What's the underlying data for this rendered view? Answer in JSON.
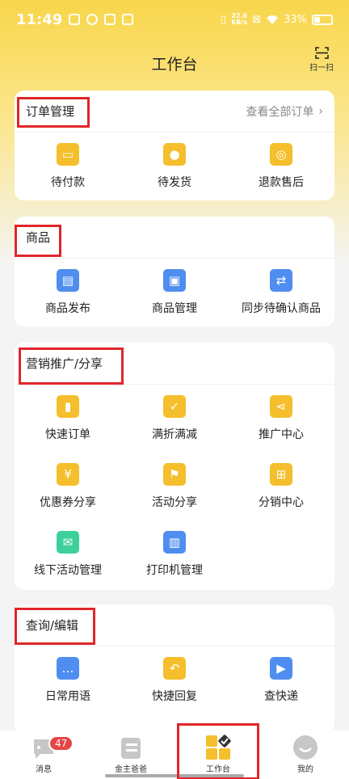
{
  "status_bar": {
    "time": "11:49",
    "net_speed_value": "22.6",
    "net_speed_unit": "KB/s",
    "battery": "33%"
  },
  "header": {
    "title": "工作台",
    "scan_label": "扫一扫"
  },
  "order_card": {
    "title": "订单管理",
    "more_link": "查看全部订单",
    "items": [
      {
        "label": "待付款",
        "icon": "ticket-icon",
        "color": "#f5be2c"
      },
      {
        "label": "待发货",
        "icon": "location-pin-icon",
        "color": "#f5be2c"
      },
      {
        "label": "退款售后",
        "icon": "refund-coin-icon",
        "color": "#f5be2c"
      }
    ]
  },
  "goods_card": {
    "title": "商品",
    "items": [
      {
        "label": "商品发布",
        "icon": "clipboard-icon",
        "color": "#4f8ef0"
      },
      {
        "label": "商品管理",
        "icon": "document-clock-icon",
        "color": "#4f8ef0"
      },
      {
        "label": "同步待确认商品",
        "icon": "sync-arrows-icon",
        "color": "#4f8ef0"
      }
    ]
  },
  "marketing_card": {
    "title": "营销推广/分享",
    "items": [
      {
        "label": "快速订单",
        "icon": "quick-order-icon",
        "color": "#f5be2c"
      },
      {
        "label": "满折满减",
        "icon": "discount-check-icon",
        "color": "#f5be2c"
      },
      {
        "label": "推广中心",
        "icon": "share-icon",
        "color": "#f5be2c"
      },
      {
        "label": "优惠券分享",
        "icon": "coupon-yen-icon",
        "color": "#f5be2c"
      },
      {
        "label": "活动分享",
        "icon": "flag-icon",
        "color": "#f5be2c"
      },
      {
        "label": "分销中心",
        "icon": "distribution-tree-icon",
        "color": "#f5be2c"
      },
      {
        "label": "线下活动管理",
        "icon": "mail-icon",
        "color": "#3ed09b"
      },
      {
        "label": "打印机管理",
        "icon": "printer-icon",
        "color": "#4f8ef0"
      }
    ]
  },
  "query_card": {
    "title": "查询/编辑",
    "items": [
      {
        "label": "日常用语",
        "icon": "chat-bubble-icon",
        "color": "#4f8ef0"
      },
      {
        "label": "快捷回复",
        "icon": "reply-icon",
        "color": "#f5be2c"
      },
      {
        "label": "查快递",
        "icon": "truck-icon",
        "color": "#4f8ef0"
      }
    ]
  },
  "tabbar": {
    "tabs": [
      {
        "label": "消息",
        "icon": "message-bubble-icon",
        "badge": "47"
      },
      {
        "label": "金主爸爸",
        "icon": "contacts-card-icon"
      },
      {
        "label": "工作台",
        "icon": "workbench-grid-icon"
      },
      {
        "label": "我的",
        "icon": "profile-face-icon"
      }
    ]
  },
  "colors": {
    "accent_yellow": "#f8d64a",
    "icon_yellow": "#f5be2c",
    "icon_blue": "#4f8ef0",
    "icon_green": "#3ed09b",
    "highlight_red": "#e0262b"
  }
}
